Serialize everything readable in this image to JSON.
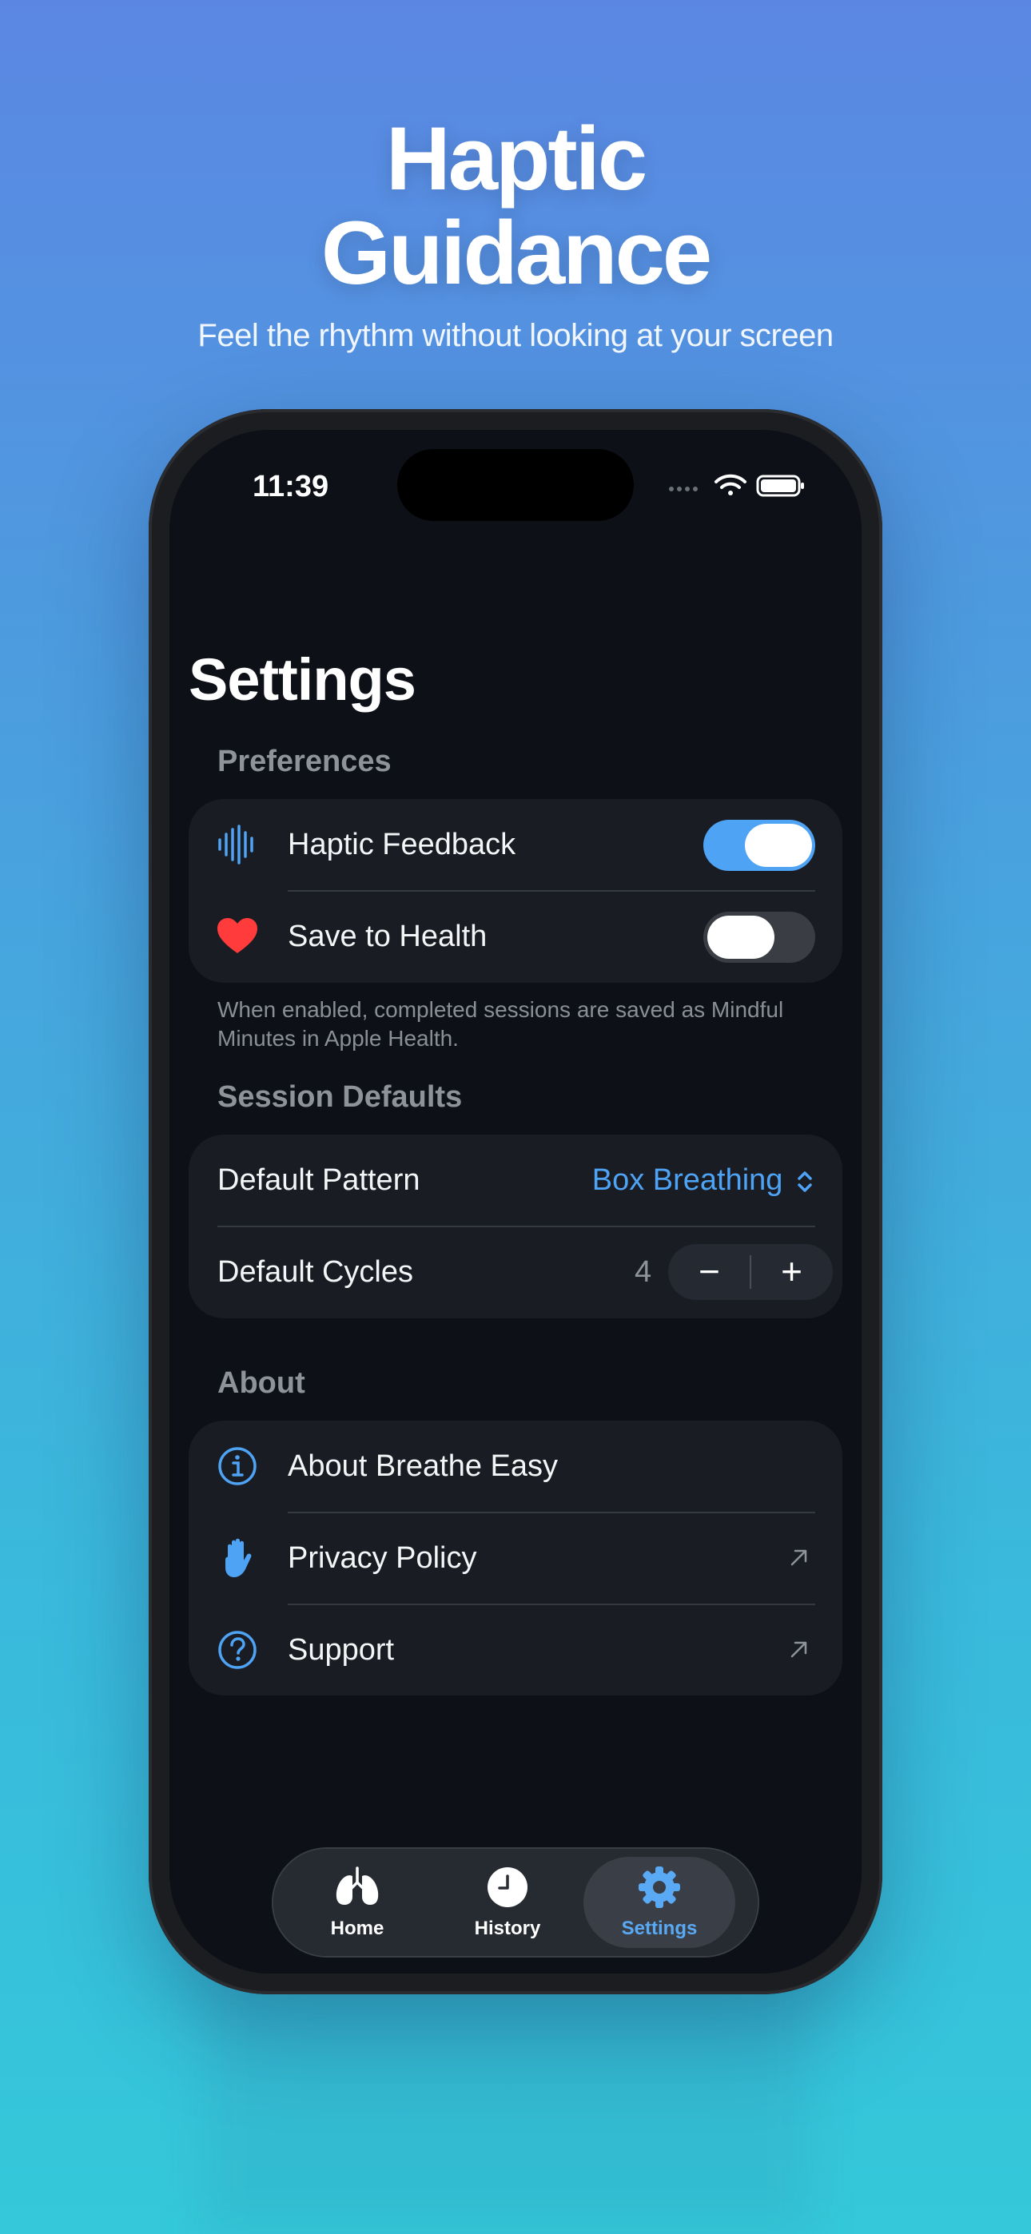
{
  "promo": {
    "headline_line1": "Haptic",
    "headline_line2": "Guidance",
    "subtitle": "Feel the rhythm without looking at your screen"
  },
  "status_bar": {
    "time": "11:39",
    "icons": [
      "cellular-dots-icon",
      "wifi-icon",
      "battery-icon"
    ]
  },
  "page": {
    "title": "Settings"
  },
  "preferences": {
    "header": "Preferences",
    "haptic": {
      "label": "Haptic Feedback",
      "icon": "waveform-icon",
      "enabled": true
    },
    "health": {
      "label": "Save to Health",
      "icon": "heart-icon",
      "enabled": false
    },
    "footnote": "When enabled, completed sessions are saved as Mindful Minutes in Apple Health."
  },
  "session_defaults": {
    "header": "Session Defaults",
    "pattern": {
      "label": "Default Pattern",
      "value": "Box Breathing"
    },
    "cycles": {
      "label": "Default Cycles",
      "value": "4",
      "decrement": "−",
      "increment": "+"
    }
  },
  "about": {
    "header": "About",
    "items": [
      {
        "label": "About Breathe Easy",
        "icon": "info-icon",
        "external": false
      },
      {
        "label": "Privacy Policy",
        "icon": "hand-icon",
        "external": true
      },
      {
        "label": "Support",
        "icon": "question-icon",
        "external": true
      }
    ]
  },
  "tabbar": {
    "tabs": [
      {
        "label": "Home",
        "icon": "lungs-icon",
        "active": false
      },
      {
        "label": "History",
        "icon": "clock-icon",
        "active": false
      },
      {
        "label": "Settings",
        "icon": "gear-icon",
        "active": true
      }
    ]
  },
  "colors": {
    "accent": "#4ea3f4",
    "toggle_on": "#4ea3f4",
    "toggle_off": "#3a3d44",
    "heart": "#ff3b3b"
  }
}
